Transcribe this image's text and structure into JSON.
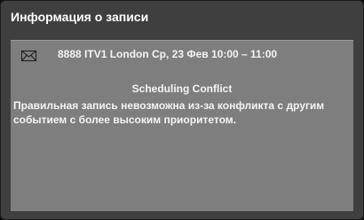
{
  "dialog": {
    "title": "Информация о записи"
  },
  "recording": {
    "icon": "envelope-icon",
    "info": "8888 ITV1 London  Ср, 23 Фев  10:00 – 11:00"
  },
  "conflict": {
    "heading": "Scheduling Conflict",
    "message": "Правильная запись невозможна из-за конфликта с другим событием с более высоким приоритетом."
  }
}
